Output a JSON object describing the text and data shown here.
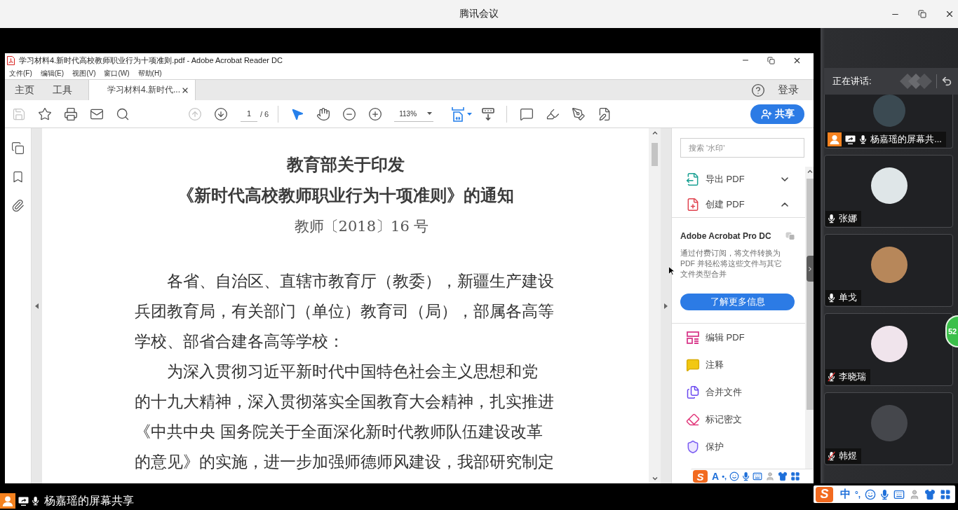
{
  "meeting": {
    "title": "腾讯会议"
  },
  "acrobat": {
    "title": "学习材料4.新时代高校教师职业行为十项准则.pdf - Adobe Acrobat Reader DC",
    "menu": [
      "文件(F)",
      "编辑(E)",
      "视图(V)",
      "窗口(W)",
      "帮助(H)"
    ],
    "tabs": [
      {
        "label": "主页",
        "kind": "nav",
        "selected": false
      },
      {
        "label": "工具",
        "kind": "nav",
        "selected": false
      },
      {
        "label": "学习材料4.新时代...",
        "kind": "document",
        "selected": true
      }
    ],
    "sign_in": "登录",
    "toolbar": {
      "save": {
        "disabled": true
      },
      "previous_page": {
        "disabled": true
      },
      "next_page": {
        "disabled": false
      },
      "page": "1",
      "page_total": "/ 6",
      "select_tool": {
        "selected": true
      },
      "hand_tool": {
        "selected": false
      },
      "zoom": "113%",
      "share": "共享"
    },
    "document": {
      "title_lines": [
        "教育部关于印发",
        "《新时代高校教师职业行为十项准则》的通知"
      ],
      "doc_number": "教师〔2018〕16 号",
      "paragraphs": [
        {
          "lines": [
            "各省、自治区、直辖市教育厅（教委），新疆生产建设",
            "兵团教育局，有关部门（单位）教育司（局），部属各高等",
            "学校、部省合建各高等学校："
          ]
        },
        {
          "lines": [
            "为深入贯彻习近平新时代中国特色社会主义思想和党",
            "的十九大精神，深入贯彻落实全国教育大会精神，扎实推进",
            "《中共中央 国务院关于全面深化新时代教师队伍建设改革",
            "的意见》的实施，进一步加强师德师风建设，我部研究制定"
          ]
        }
      ]
    },
    "tools_panel": {
      "search_placeholder": "搜索 '水印'",
      "sections": [
        {
          "label": "导出 PDF",
          "kind": "export",
          "expanded": false
        },
        {
          "label": "创建 PDF",
          "kind": "create",
          "expanded": true,
          "promo": {
            "title": "Adobe Acrobat Pro DC",
            "text": "通过付费订阅，将文件转换为 PDF 并轻松将这些文件与其它文件类型合并",
            "button": "了解更多信息"
          }
        }
      ],
      "tools": [
        {
          "label": "编辑 PDF",
          "kind": "edit"
        },
        {
          "label": "注释",
          "kind": "comment"
        },
        {
          "label": "合并文件",
          "kind": "combine"
        },
        {
          "label": "标记密文",
          "kind": "redact"
        },
        {
          "label": "保护",
          "kind": "protect"
        }
      ]
    },
    "ime_toolbar": {
      "logo": "S",
      "mode": "A",
      "punctuation": "•,"
    }
  },
  "participants": {
    "header": "正在讲话:",
    "list": [
      {
        "name": "杨嘉瑶的屏幕共...",
        "kind": "screen_share",
        "muted": false
      },
      {
        "name": "张娜",
        "kind": "member",
        "muted": false
      },
      {
        "name": "单戈",
        "kind": "member",
        "muted": false
      },
      {
        "name": "李晓瑞",
        "kind": "member",
        "muted": true
      },
      {
        "name": "韩煜",
        "kind": "member",
        "muted": true
      }
    ]
  },
  "floating_badge": "52",
  "bottom_bar": {
    "presenter": "杨嘉瑶的屏幕共享"
  },
  "ime_toolbar": {
    "logo": "S",
    "mode": "中",
    "punctuation": "°,"
  }
}
